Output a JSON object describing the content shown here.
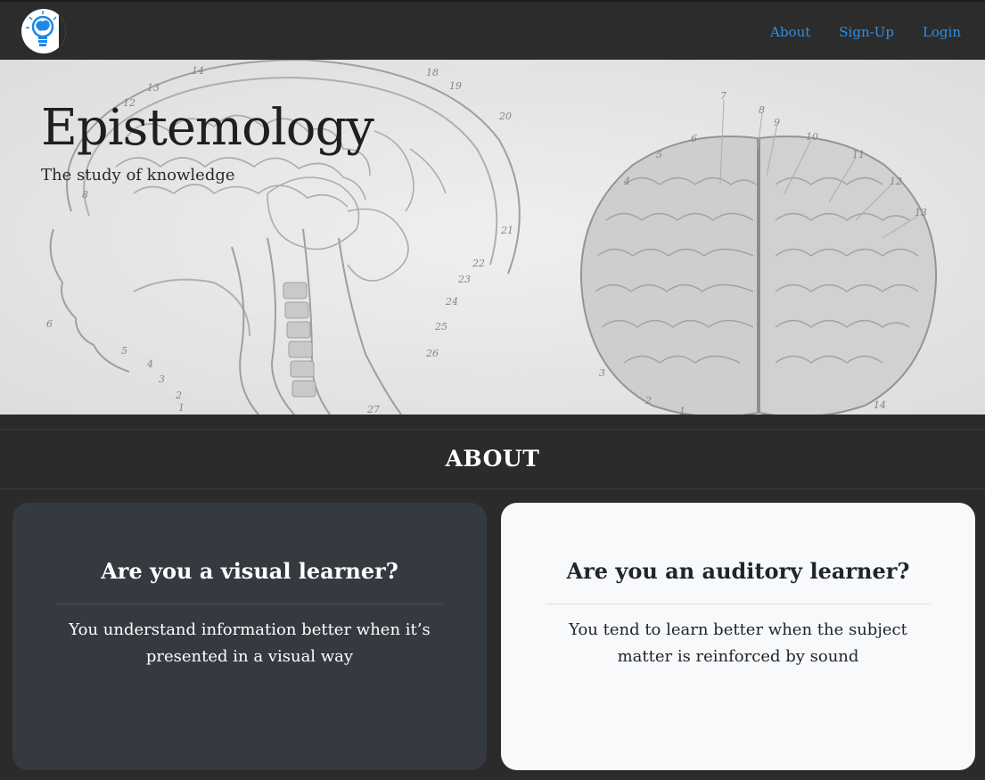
{
  "navbar": {
    "logo_icon": "brain-lightbulb-icon",
    "links": [
      "About",
      "Sign-Up",
      "Login"
    ],
    "link_color": "#2f8fe3"
  },
  "hero": {
    "title": "Epistemology",
    "subtitle": "The study of knowledge"
  },
  "about": {
    "heading": "ABOUT"
  },
  "cards": [
    {
      "title": "Are you a visual learner?",
      "text": "You understand information better when it’s presented in a visual way"
    },
    {
      "title": "Are you an auditory learner?",
      "text": "You tend to learn better when the subject matter is reinforced by sound"
    }
  ]
}
